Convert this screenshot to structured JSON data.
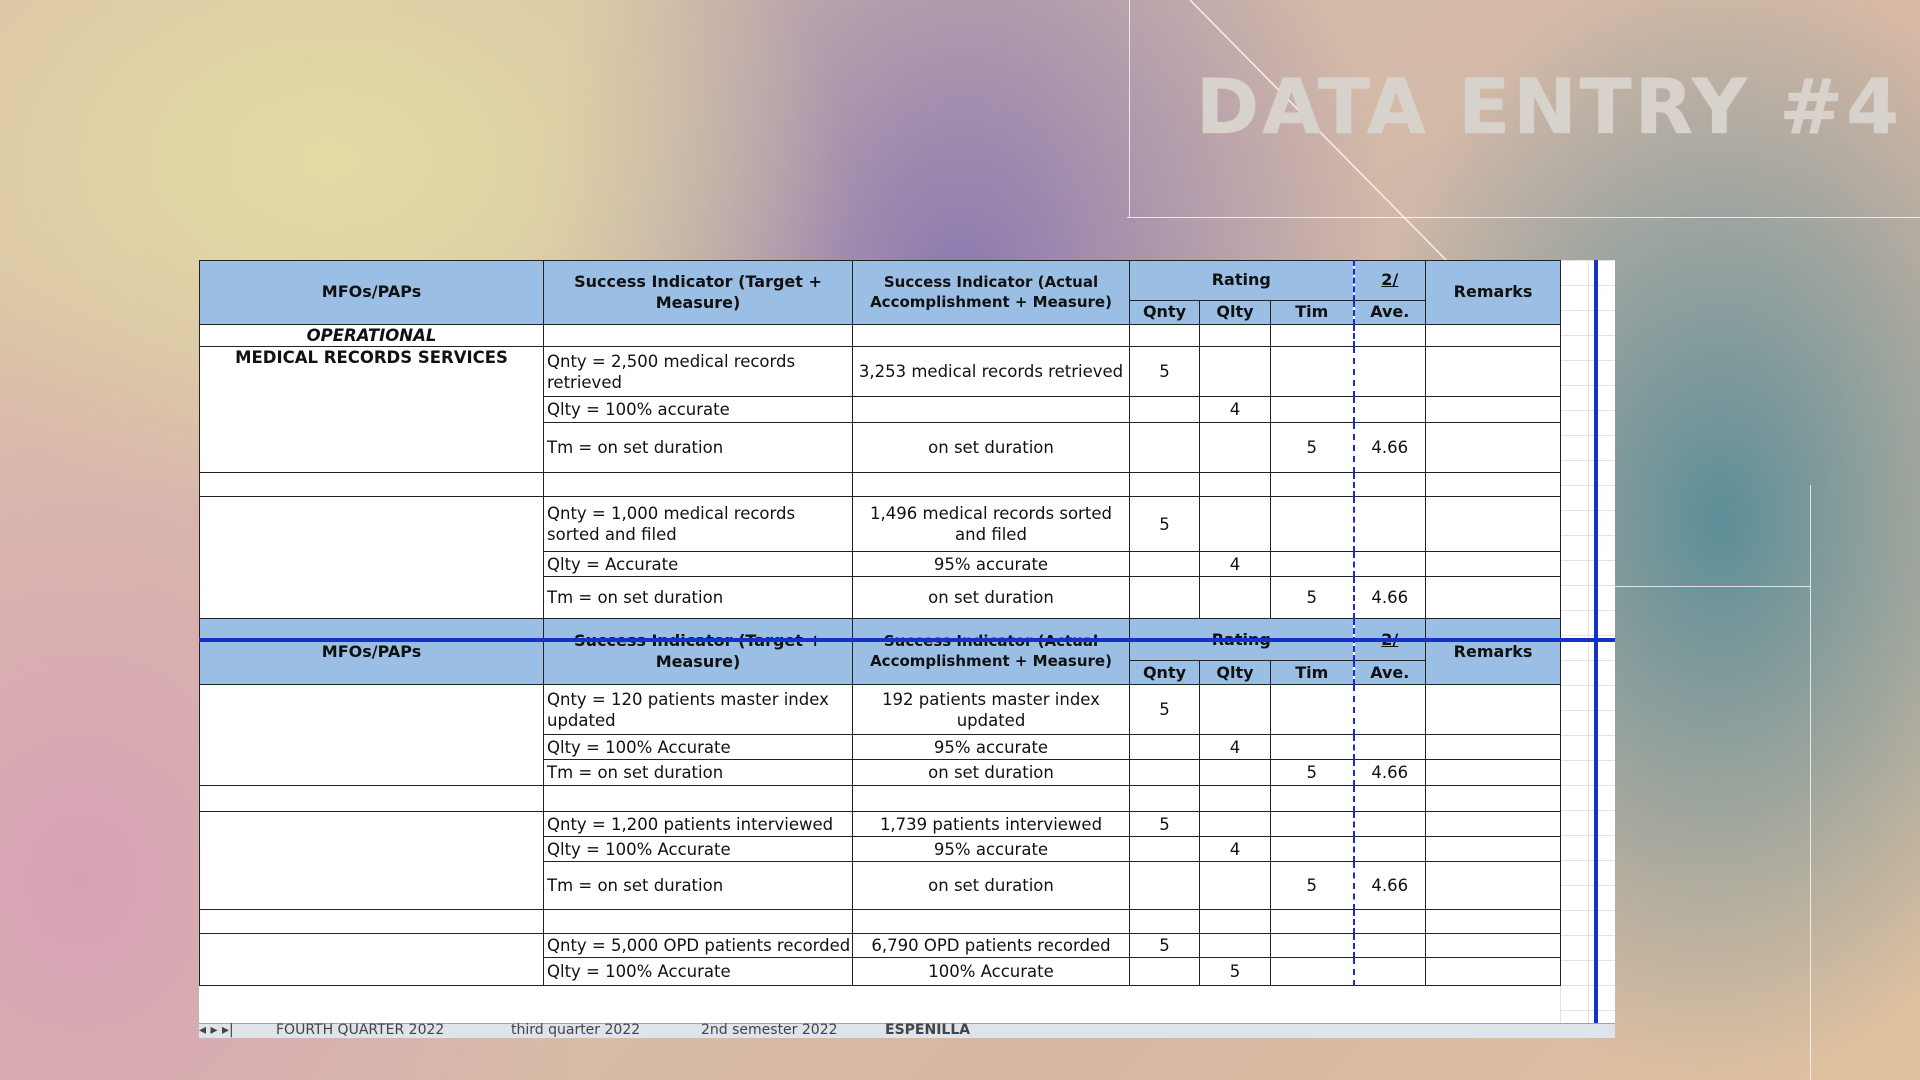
{
  "slide": {
    "title": "DATA ENTRY #4"
  },
  "headers": {
    "mfo": "MFOs/PAPs",
    "target": "Success Indicator  (Target + Measure)",
    "actual": "Success Indicator (Actual Accomplishment + Measure)",
    "rating": "Rating",
    "two": "2/",
    "remarks": "Remarks",
    "qnty": "Qnty",
    "qlty": "Qlty",
    "tim": "Tim",
    "ave": "Ave."
  },
  "section": {
    "operational": "OPERATIONAL",
    "mrs": "MEDICAL RECORDS SERVICES"
  },
  "rows": [
    {
      "target": "Qnty = 2,500 medical records retrieved",
      "actual": "3,253 medical records retrieved",
      "qnty": "5",
      "qlty": "",
      "tim": "",
      "ave": ""
    },
    {
      "target": "Qlty = 100% accurate",
      "actual": "",
      "qnty": "",
      "qlty": "4",
      "tim": "",
      "ave": ""
    },
    {
      "target": "Tm = on set duration",
      "actual": "on set duration",
      "qnty": "",
      "qlty": "",
      "tim": "5",
      "ave": "4.66"
    },
    {
      "target": "Qnty = 1,000 medical records sorted and filed",
      "actual": "1,496 medical records sorted and filed",
      "qnty": "5",
      "qlty": "",
      "tim": "",
      "ave": ""
    },
    {
      "target": "Qlty = Accurate",
      "actual": "95% accurate",
      "qnty": "",
      "qlty": "4",
      "tim": "",
      "ave": ""
    },
    {
      "target": "Tm = on set duration",
      "actual": "on set duration",
      "qnty": "",
      "qlty": "",
      "tim": "5",
      "ave": "4.66"
    },
    {
      "target": "Qnty = 120 patients master index updated",
      "actual": "192 patients master index updated",
      "qnty": "5",
      "qlty": "",
      "tim": "",
      "ave": ""
    },
    {
      "target": "Qlty = 100% Accurate",
      "actual": "95% accurate",
      "qnty": "",
      "qlty": "4",
      "tim": "",
      "ave": ""
    },
    {
      "target": "Tm = on set duration",
      "actual": "on set duration",
      "qnty": "",
      "qlty": "",
      "tim": "5",
      "ave": "4.66"
    },
    {
      "target": "Qnty = 1,200 patients interviewed",
      "actual": "1,739 patients interviewed",
      "qnty": "5",
      "qlty": "",
      "tim": "",
      "ave": ""
    },
    {
      "target": "Qlty = 100% Accurate",
      "actual": "95% accurate",
      "qnty": "",
      "qlty": "4",
      "tim": "",
      "ave": ""
    },
    {
      "target": "Tm =  on set duration",
      "actual": "on set duration",
      "qnty": "",
      "qlty": "",
      "tim": "5",
      "ave": "4.66"
    },
    {
      "target": "Qnty = 5,000 OPD patients recorded",
      "actual": "6,790 OPD patients recorded",
      "qnty": "5",
      "qlty": "",
      "tim": "",
      "ave": ""
    },
    {
      "target": "Qlty = 100% Accurate",
      "actual": "100% Accurate",
      "qnty": "",
      "qlty": "5",
      "tim": "",
      "ave": ""
    }
  ],
  "tabs": [
    "FOURTH QUARTER 2022",
    "third quarter 2022",
    "2nd semester 2022",
    "ESPENILLA"
  ],
  "colors": {
    "header_fill": "#9bbfe4",
    "frame_blue": "#1432c8"
  }
}
